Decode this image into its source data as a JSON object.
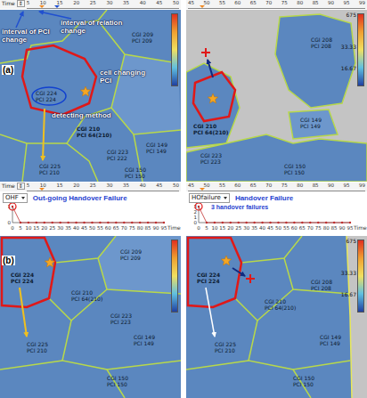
{
  "timelines": [
    {
      "label": "Time",
      "spinner": "⇕",
      "halves": [
        {
          "ticks": [
            "5",
            "10",
            "15",
            "20",
            "25",
            "30",
            "35",
            "40",
            "45",
            "50"
          ],
          "thumbs": [
            {
              "level": 0.1,
              "color": "#f08a24"
            },
            {
              "level": 0.2,
              "color": "#2050d0"
            }
          ]
        },
        {
          "ticks": [
            "45",
            "50",
            "55",
            "60",
            "65",
            "70",
            "75",
            "80",
            "85",
            "90",
            "95",
            "99"
          ],
          "thumbs": [
            {
              "level": 0.08,
              "color": "#f08a24"
            }
          ]
        }
      ]
    },
    {
      "label": "Time",
      "spinner": "⇕",
      "halves": [
        {
          "ticks": [
            "5",
            "10",
            "15",
            "20",
            "25",
            "30",
            "35",
            "40",
            "45",
            "50"
          ],
          "thumbs": [
            {
              "level": 0.1,
              "color": "#f08a24"
            }
          ]
        },
        {
          "ticks": [
            "45",
            "50",
            "55",
            "60",
            "65",
            "70",
            "75",
            "80",
            "85",
            "90",
            "95",
            "99"
          ],
          "thumbs": [
            {
              "level": 0.08,
              "color": "#f08a24"
            }
          ]
        }
      ]
    }
  ],
  "panels": [
    {
      "label": "(a)",
      "maps": [
        {
          "cells": [
            {
              "cgi": "CGI 209",
              "pci": "PCI 209",
              "selected": false
            },
            {
              "cgi": "CGI 224",
              "pci": "PCI 224",
              "selected": false
            },
            {
              "cgi": "CGI 210",
              "pci": "PCI 64(210)",
              "selected": true
            },
            {
              "cgi": "CGI 223",
              "pci": "PCI 222",
              "selected": false
            },
            {
              "cgi": "CGI 149",
              "pci": "PCI 149",
              "selected": false
            },
            {
              "cgi": "CGI 225",
              "pci": "PCI 210",
              "selected": false
            },
            {
              "cgi": "CGI 150",
              "pci": "PCI 150",
              "selected": false
            }
          ],
          "annotations": [
            {
              "text": "interval of PCI change",
              "color": "#ffffff"
            },
            {
              "text": "interval of relation change",
              "color": "#ffffff"
            },
            {
              "text": "cell changing PCI",
              "color": "#ffffff"
            },
            {
              "text": "detecting method",
              "color": "#ffffff"
            }
          ],
          "legend": []
        },
        {
          "cells": [
            {
              "cgi": "CGI 208",
              "pci": "PCI 208",
              "selected": false
            },
            {
              "cgi": "CGI 210",
              "pci": "PCI 64(210)",
              "selected": true
            },
            {
              "cgi": "CGI 223",
              "pci": "PCI 223",
              "selected": false
            },
            {
              "cgi": "CGI 149",
              "pci": "PCI 149",
              "selected": false
            },
            {
              "cgi": "CGI 150",
              "pci": "PCI 150",
              "selected": false
            }
          ],
          "annotations": [],
          "legend": [
            "675",
            "33.33",
            "16.67"
          ]
        }
      ]
    },
    {
      "label": "(b)",
      "maps": [
        {
          "cells": [
            {
              "cgi": "CGI 224",
              "pci": "PCI 224",
              "selected": true
            },
            {
              "cgi": "CGI 209",
              "pci": "PCI 209",
              "selected": false
            },
            {
              "cgi": "CGI 210",
              "pci": "PCI 64(210)",
              "selected": false
            },
            {
              "cgi": "CGI 223",
              "pci": "PCI 223",
              "selected": false
            },
            {
              "cgi": "CGI 149",
              "pci": "PCI 149",
              "selected": false
            },
            {
              "cgi": "CGI 225",
              "pci": "PCI 210",
              "selected": false
            },
            {
              "cgi": "CGI 150",
              "pci": "PCI 150",
              "selected": false
            }
          ],
          "annotations": [],
          "legend": []
        },
        {
          "cells": [
            {
              "cgi": "CGI 208",
              "pci": "PCI 208",
              "selected": false
            },
            {
              "cgi": "CGI 224",
              "pci": "PCI 224",
              "selected": true
            },
            {
              "cgi": "CGI 210",
              "pci": "PCI 64(210)",
              "selected": false
            },
            {
              "cgi": "CGI 225",
              "pci": "PCI 210",
              "selected": false
            },
            {
              "cgi": "CGI 149",
              "pci": "PCI 149",
              "selected": false
            },
            {
              "cgi": "CGI 150",
              "pci": "PCI 150",
              "selected": false
            }
          ],
          "annotations": [],
          "legend": [
            "675",
            "33.33",
            "16.67"
          ]
        }
      ]
    }
  ],
  "charts": [
    {
      "dropdown": "OHF",
      "title": "Out-going Handover Failure",
      "x_ticks": [
        "0",
        "5",
        "10",
        "15",
        "20",
        "25",
        "30",
        "35",
        "40",
        "45",
        "50",
        "55",
        "60",
        "65",
        "70",
        "75",
        "80",
        "85",
        "90",
        "95"
      ],
      "x_label": "Time",
      "y_ticks": [
        "0",
        "1"
      ],
      "values": [
        1,
        0,
        0,
        0,
        0,
        0,
        0,
        0,
        0,
        0,
        0,
        0,
        0,
        0,
        0,
        0,
        0,
        0,
        0,
        0
      ],
      "highlight": 0
    },
    {
      "dropdown": "HOfailure",
      "title": "Handover Failure",
      "note": "3 handover failures",
      "x_ticks": [
        "0",
        "5",
        "10",
        "15",
        "20",
        "25",
        "30",
        "35",
        "40",
        "45",
        "50",
        "55",
        "60",
        "65",
        "70",
        "75",
        "80",
        "85",
        "90",
        "95"
      ],
      "x_label": "Time",
      "y_ticks": [
        "0",
        "1",
        "2",
        "3"
      ],
      "values": [
        3,
        0,
        0,
        0,
        0,
        0,
        0,
        0,
        0,
        0,
        0,
        0,
        0,
        0,
        0,
        0,
        0,
        0,
        0,
        0
      ],
      "highlight": 0
    }
  ]
}
